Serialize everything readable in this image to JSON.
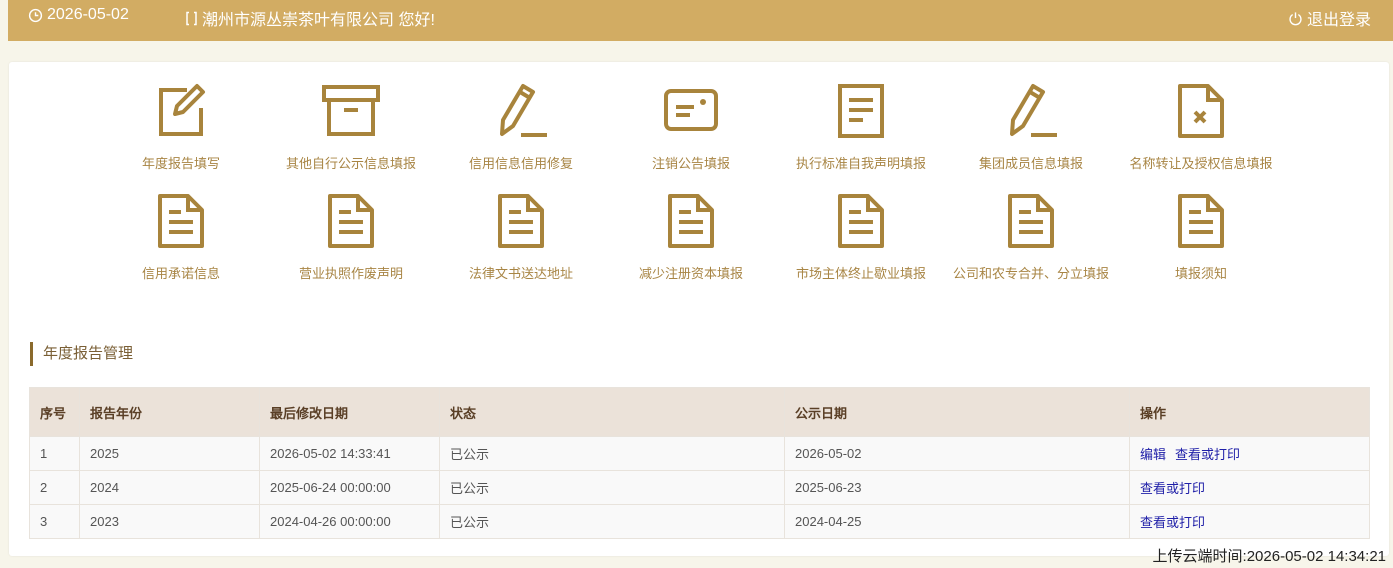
{
  "header": {
    "date": "2026-05-02",
    "greeting": "潮州市源丛崇茶叶有限公司 您好!",
    "logout_label": "退出登录"
  },
  "tiles": [
    {
      "label": "年度报告填写",
      "icon": "edit-icon"
    },
    {
      "label": "其他自行公示信息填报",
      "icon": "archive-box-icon"
    },
    {
      "label": "信用信息信用修复",
      "icon": "pencil-icon"
    },
    {
      "label": "注销公告填报",
      "icon": "card-icon"
    },
    {
      "label": "执行标准自我声明填报",
      "icon": "document-icon"
    },
    {
      "label": "集团成员信息填报",
      "icon": "pencil-icon"
    },
    {
      "label": "名称转让及授权信息填报",
      "icon": "document-x-icon"
    },
    {
      "label": "信用承诺信息",
      "icon": "document-icon"
    },
    {
      "label": "营业执照作废声明",
      "icon": "document-icon"
    },
    {
      "label": "法律文书送达地址",
      "icon": "document-icon"
    },
    {
      "label": "减少注册资本填报",
      "icon": "document-icon"
    },
    {
      "label": "市场主体终止歇业填报",
      "icon": "document-icon"
    },
    {
      "label": "公司和农专合并、分立填报",
      "icon": "document-icon"
    },
    {
      "label": "填报须知",
      "icon": "document-icon"
    }
  ],
  "section_title": "年度报告管理",
  "table": {
    "headers": [
      "序号",
      "报告年份",
      "最后修改日期",
      "状态",
      "公示日期",
      "操作"
    ],
    "rows": [
      {
        "no": "1",
        "year": "2025",
        "modified": "2026-05-02 14:33:41",
        "status": "已公示",
        "publish": "2026-05-02",
        "actions": [
          "编辑",
          "查看或打印"
        ]
      },
      {
        "no": "2",
        "year": "2024",
        "modified": "2025-06-24 00:00:00",
        "status": "已公示",
        "publish": "2025-06-23",
        "actions": [
          "查看或打印"
        ]
      },
      {
        "no": "3",
        "year": "2023",
        "modified": "2024-04-26 00:00:00",
        "status": "已公示",
        "publish": "2024-04-25",
        "actions": [
          "查看或打印"
        ]
      }
    ]
  },
  "footer": {
    "upload_time": "上传云端时间:2026-05-02 14:34:21"
  },
  "colors": {
    "header_bg": "#d2ac63",
    "icon": "#a8843c",
    "table_header_bg": "#ebe2d9",
    "link": "#1f1fa8"
  }
}
